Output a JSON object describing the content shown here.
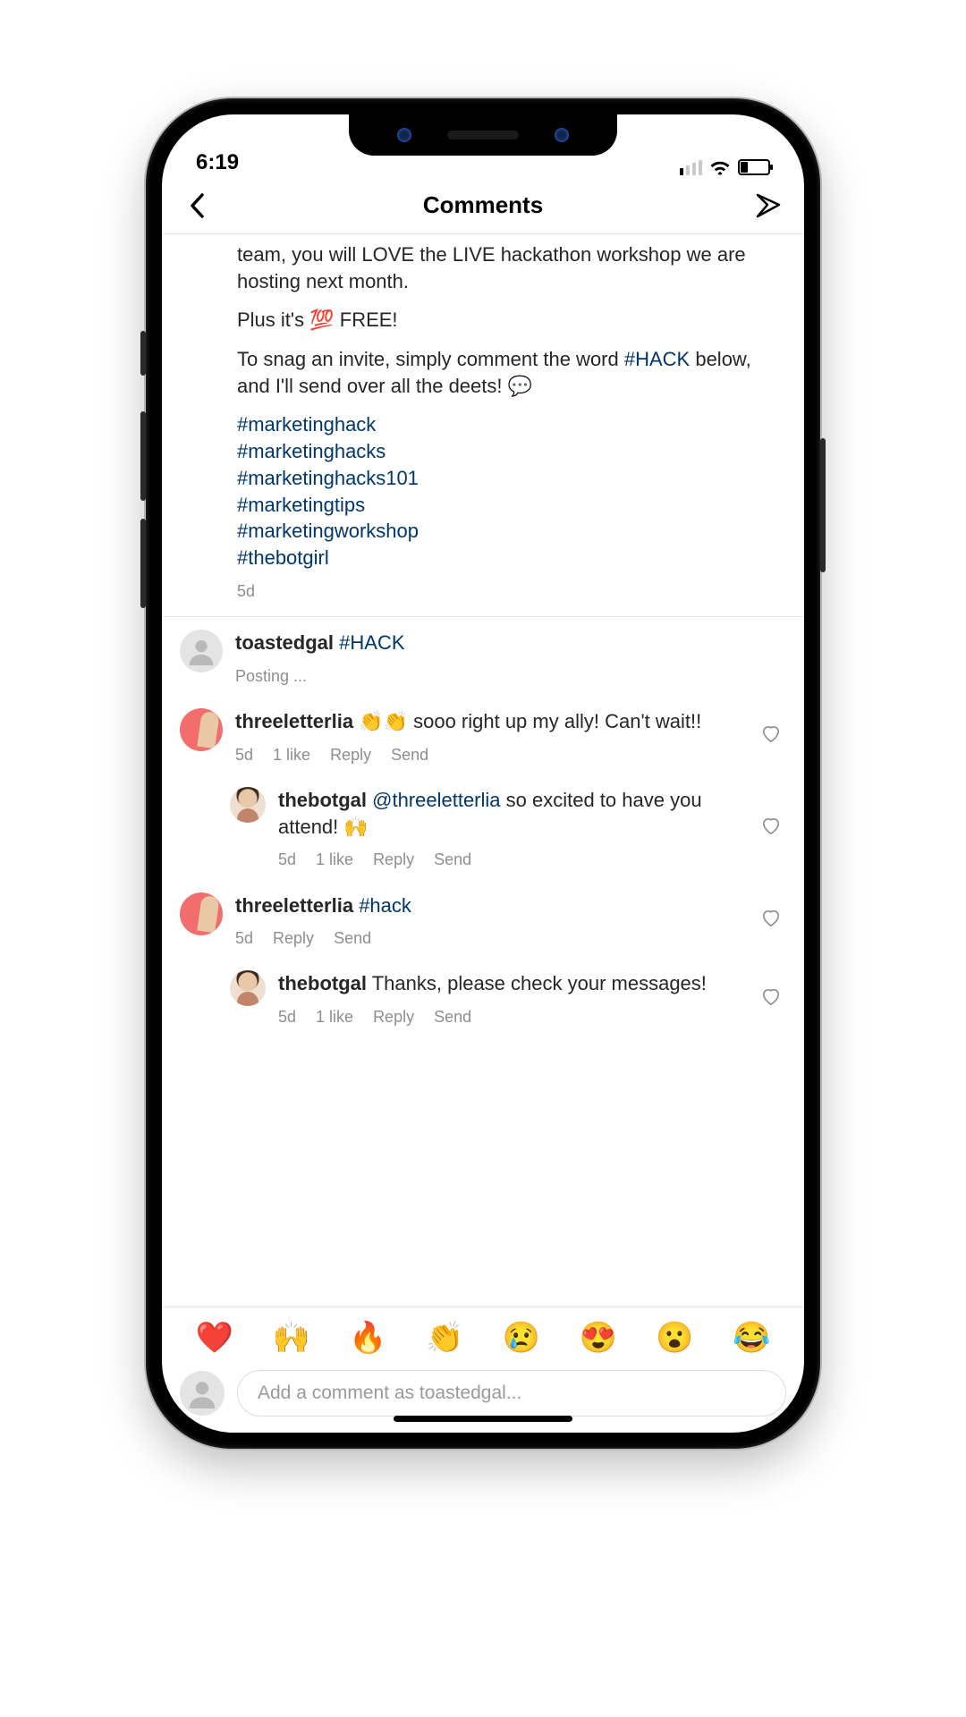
{
  "status": {
    "time": "6:19"
  },
  "header": {
    "title": "Comments"
  },
  "post": {
    "caption_line1": "team, you will LOVE the LIVE hackathon workshop we are hosting next month.",
    "caption_line2_pre": "Plus it's ",
    "caption_line2_emoji": "💯",
    "caption_line2_post": " FREE!",
    "caption_line3_pre": "To snag an invite, simply comment the word ",
    "caption_line3_hash": "#HACK",
    "caption_line3_post": " below, and I'll send over all the deets! 💬",
    "tags": {
      "t1": "#marketinghack",
      "t2": "#marketinghacks",
      "t3": "#marketinghacks101",
      "t4": "#marketingtips",
      "t5": "#marketingworkshop",
      "t6": "#thebotgirl"
    },
    "time": "5d"
  },
  "comments": {
    "c1": {
      "user": "toastedgal",
      "hashtag": "#HACK",
      "status": "Posting ..."
    },
    "c2": {
      "user": "threeletterlia",
      "emoji": "👏👏",
      "text": " sooo right up my ally! Can't wait!!",
      "time": "5d",
      "likes": "1 like",
      "reply": "Reply",
      "send": "Send"
    },
    "r2": {
      "user": "thebotgal",
      "mention": "@threeletterlia",
      "text_post": " so excited to have you attend! 🙌",
      "time": "5d",
      "likes": "1 like",
      "reply": "Reply",
      "send": "Send"
    },
    "c3": {
      "user": "threeletterlia",
      "hashtag": "#hack",
      "time": "5d",
      "reply": "Reply",
      "send": "Send"
    },
    "r3": {
      "user": "thebotgal",
      "text": " Thanks, please check your messages!",
      "time": "5d",
      "likes": "1 like",
      "reply": "Reply",
      "send": "Send"
    }
  },
  "emoji_row": {
    "e1": "❤️",
    "e2": "🙌",
    "e3": "🔥",
    "e4": "👏",
    "e5": "😢",
    "e6": "😍",
    "e7": "😮",
    "e8": "😂"
  },
  "compose": {
    "placeholder": "Add a comment as toastedgal..."
  }
}
